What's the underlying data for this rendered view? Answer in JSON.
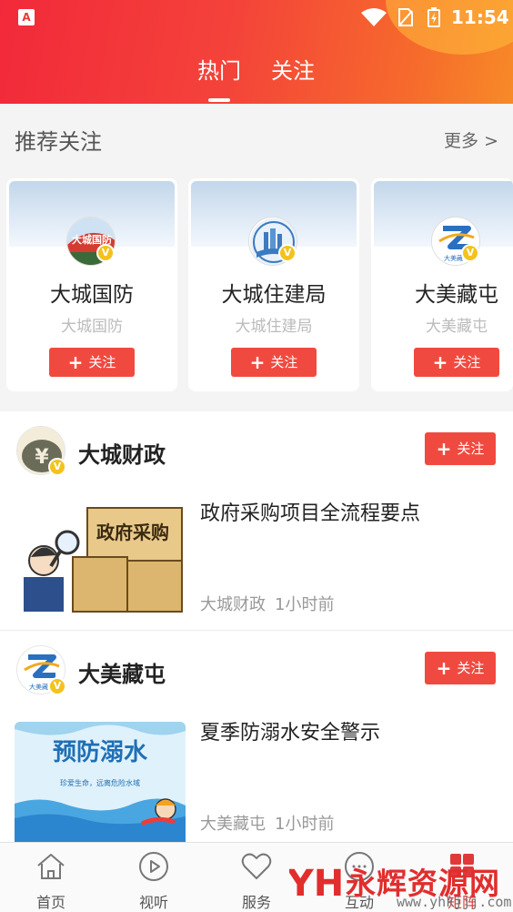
{
  "status_bar": {
    "app_badge": "A",
    "time": "11:54"
  },
  "header": {
    "tabs": [
      {
        "label": "热门",
        "active": true
      },
      {
        "label": "关注",
        "active": false
      }
    ]
  },
  "recommend": {
    "title": "推荐关注",
    "more_label": "更多 >",
    "cards": [
      {
        "name": "大城国防",
        "subtitle": "大城国防",
        "follow_label": "关注",
        "avatar_text": "大城国防"
      },
      {
        "name": "大城住建局",
        "subtitle": "大城住建局",
        "follow_label": "关注"
      },
      {
        "name": "大美藏屯",
        "subtitle": "大美藏屯",
        "follow_label": "关注",
        "avatar_text": "大美藏屯"
      }
    ]
  },
  "feed": [
    {
      "account": "大城财政",
      "follow_label": "关注",
      "title": "政府采购项目全流程要点",
      "source": "大城财政",
      "time": "1小时前",
      "thumb_text": "政府采购"
    },
    {
      "account": "大美藏屯",
      "follow_label": "关注",
      "title": "夏季防溺水安全警示",
      "source": "大美藏屯",
      "time": "1小时前",
      "thumb_text": "预防溺水",
      "thumb_subtext": "珍爱生命，远离危险水域",
      "avatar_text": "大美藏屯"
    }
  ],
  "bottom_nav": [
    {
      "label": "首页",
      "icon": "home-icon"
    },
    {
      "label": "视听",
      "icon": "play-icon"
    },
    {
      "label": "服务",
      "icon": "heart-icon"
    },
    {
      "label": "互动",
      "icon": "chat-icon"
    },
    {
      "label": "矩阵",
      "icon": "grid-icon",
      "active": true
    }
  ],
  "watermark": {
    "text": "永辉资源网",
    "url": "www.yhkjjj.com",
    "logo_text": "YH"
  },
  "colors": {
    "accent": "#f04a40",
    "header_start": "#f2293a",
    "header_end": "#f78a27",
    "verified": "#f4c21f"
  }
}
